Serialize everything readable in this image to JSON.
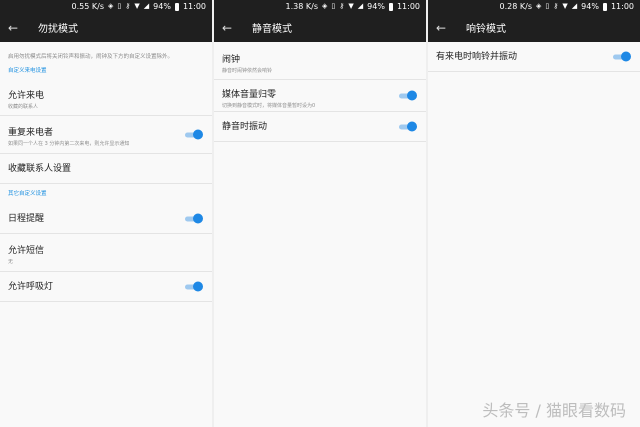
{
  "statusbar": {
    "left": {
      "speed": "0.55 K/s",
      "battery": "94%",
      "time": "11:00"
    },
    "middle": {
      "speed": "1.38 K/s",
      "battery": "94%",
      "time": "11:00"
    },
    "right": {
      "speed": "0.28 K/s",
      "battery": "94%",
      "time": "11:00"
    }
  },
  "dnd": {
    "title": "勿扰模式",
    "description": "启用勿扰模式后将关闭铃声和振动，闹钟及下方的自定义设置除外。",
    "section1": "自定义来电设置",
    "allow_calls": {
      "label": "允许来电",
      "sub": "收藏的联系人"
    },
    "repeat_callers": {
      "label": "重复来电者",
      "sub": "如果同一个人在 3 分钟内第二次来电，则允许显示通知",
      "on": true
    },
    "favorites": {
      "label": "收藏联系人设置"
    },
    "section2": "其它自定义设置",
    "calendar": {
      "label": "日程提醒",
      "on": true
    },
    "sms": {
      "label": "允许短信",
      "sub": "无"
    },
    "breathing_light": {
      "label": "允许呼吸灯",
      "on": true
    }
  },
  "silent": {
    "title": "静音模式",
    "alarm": {
      "label": "闹钟",
      "sub": "静音时闹钟依然会响铃"
    },
    "media_mute": {
      "label": "媒体音量归零",
      "sub": "切换到静音模式时，将媒体音量暂时设为0",
      "on": true
    },
    "vibrate": {
      "label": "静音时振动",
      "on": true
    }
  },
  "ring": {
    "title": "响铃模式",
    "vibrate_on_ring": {
      "label": "有来电时响铃并振动",
      "on": true
    }
  },
  "watermark": "头条号 / 猫眼看数码"
}
